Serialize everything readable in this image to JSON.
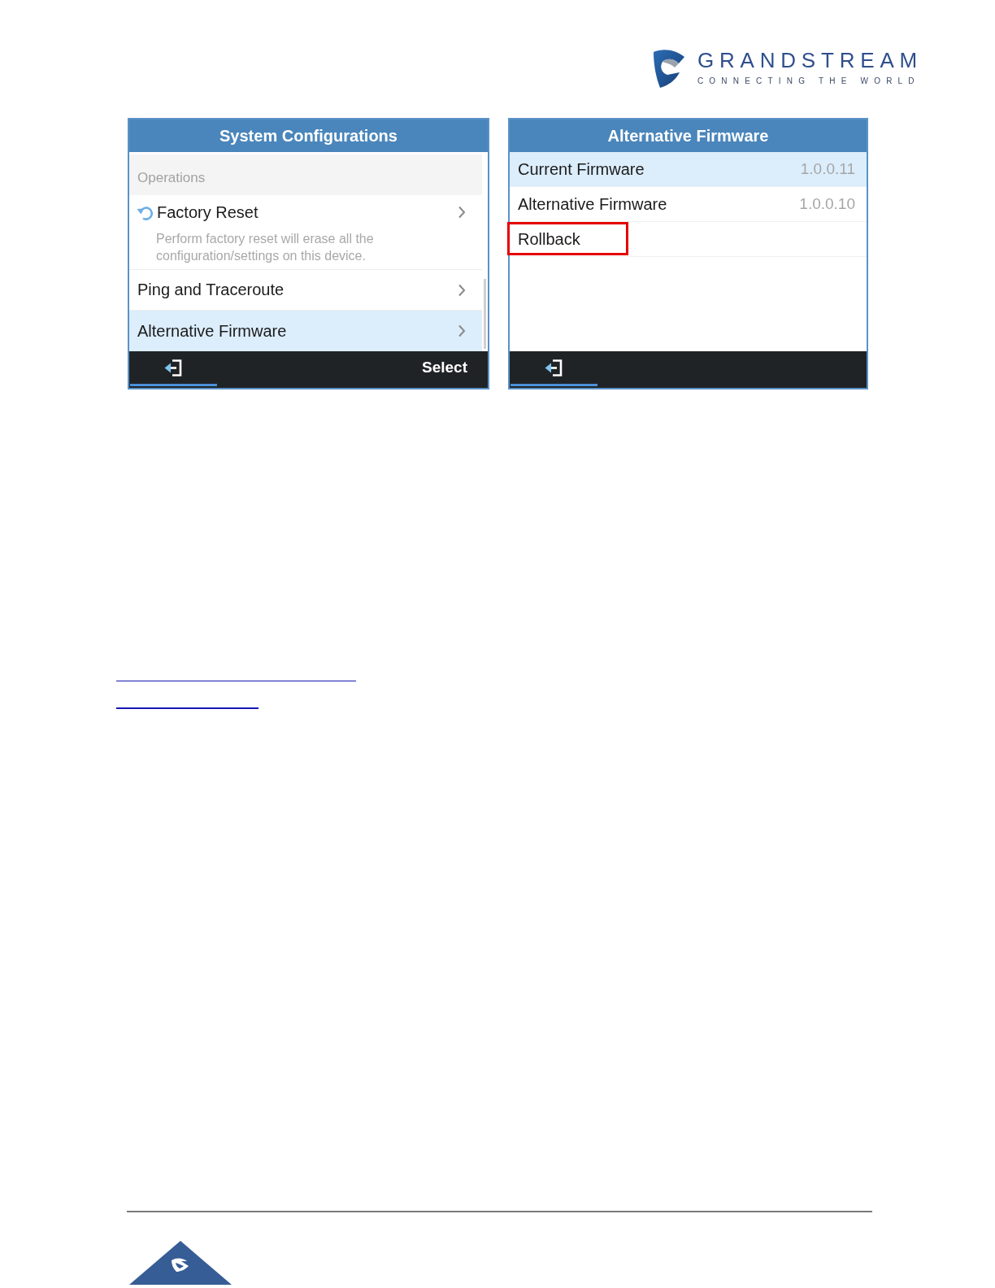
{
  "logo": {
    "brand": "GRANDSTREAM",
    "tagline": "CONNECTING THE WORLD"
  },
  "screens": [
    {
      "title": "System Configurations",
      "scrollbar": true,
      "items": [
        {
          "kind": "section",
          "label": "Operations"
        },
        {
          "kind": "operation",
          "label": "Factory Reset",
          "description": "Perform factory reset will erase all the configuration/settings on this device.",
          "selected": false
        },
        {
          "kind": "link",
          "label": "Ping and Traceroute",
          "selected": false
        },
        {
          "kind": "link",
          "label": "Alternative Firmware",
          "selected": true
        }
      ],
      "softkeys": [
        {
          "kind": "back",
          "selected": true
        },
        {
          "kind": "text",
          "label": "Select",
          "selected": false
        }
      ]
    },
    {
      "title": "Alternative Firmware",
      "items": [
        {
          "kind": "info",
          "label": "Current Firmware",
          "value": "1.0.0.11",
          "selected": true,
          "outlined": false
        },
        {
          "kind": "info",
          "label": "Alternative Firmware",
          "value": "1.0.0.10",
          "selected": false,
          "outlined": false
        },
        {
          "kind": "action",
          "label": "Rollback",
          "selected": false,
          "outlined": true
        }
      ],
      "softkeys": [
        {
          "kind": "back",
          "selected": true
        }
      ]
    }
  ]
}
